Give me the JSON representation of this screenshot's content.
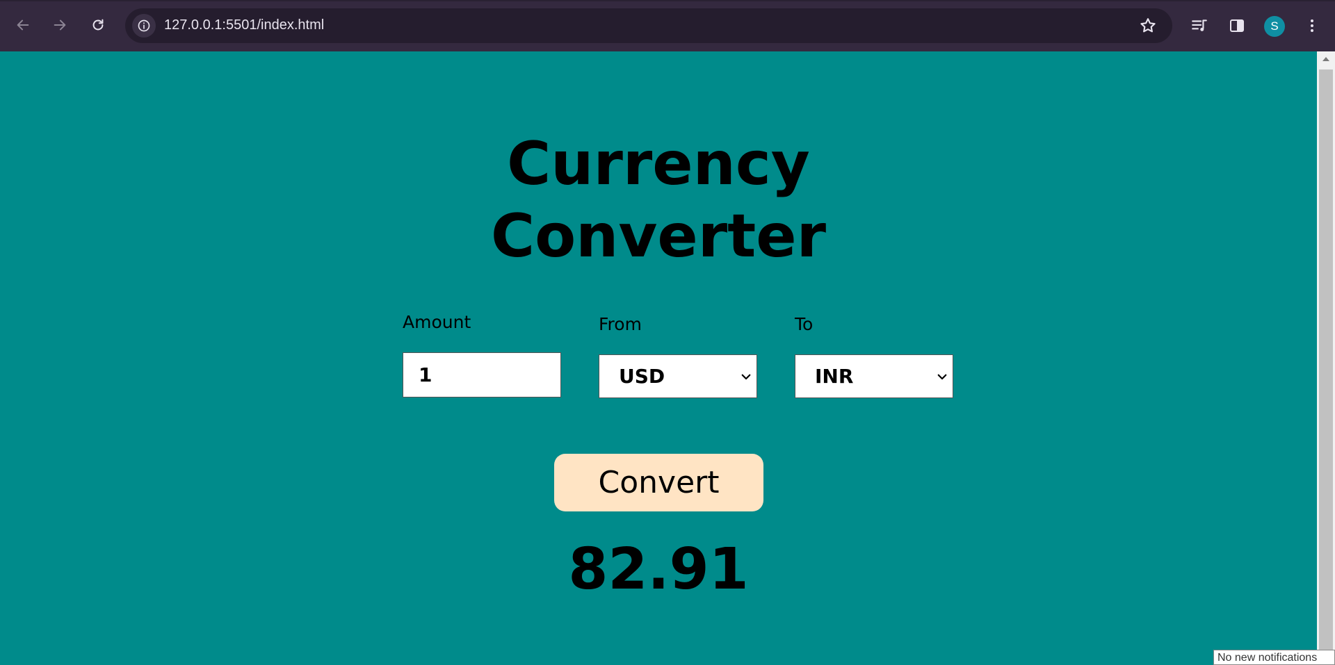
{
  "browser": {
    "url": "127.0.0.1:5501/index.html",
    "profile_initial": "S",
    "icons": {
      "back": "arrow-left-icon",
      "forward": "arrow-right-icon",
      "reload": "reload-icon",
      "site_info": "info-icon",
      "bookmark": "star-icon",
      "media": "media-queue-icon",
      "side_panel": "side-panel-icon",
      "menu": "kebab-menu-icon"
    },
    "colors": {
      "frame": "#34293f",
      "omnibox": "#251d2e",
      "avatar": "#0f8fa3"
    }
  },
  "page": {
    "background": "#008b8b",
    "title_line1": "Currency",
    "title_line2": "Converter",
    "amount": {
      "label": "Amount",
      "value": "1"
    },
    "from": {
      "label": "From",
      "value": "USD"
    },
    "to": {
      "label": "To",
      "value": "INR"
    },
    "convert_label": "Convert",
    "convert_color": "#ffe4c4",
    "result": "82.91"
  },
  "notification": "No new notifications"
}
